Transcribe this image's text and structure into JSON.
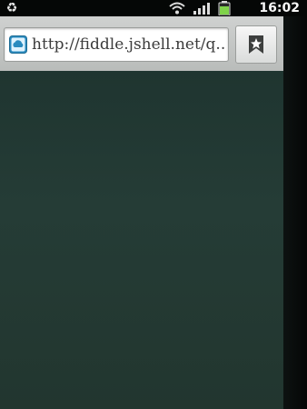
{
  "status_bar": {
    "left_icon": "recycle-icon",
    "icons": [
      "wifi-icon",
      "signal-icon",
      "battery-icon"
    ],
    "time": "16:02"
  },
  "browser": {
    "url": "http://fiddle.jshell.net/q...",
    "favicon": "cloud-icon",
    "bookmark_icon": "bookmark-star-icon"
  },
  "colors": {
    "page_background": "#253c36",
    "title_bar": "#c8cac9",
    "status_bar": "#050706",
    "battery": "#7fd24a"
  }
}
